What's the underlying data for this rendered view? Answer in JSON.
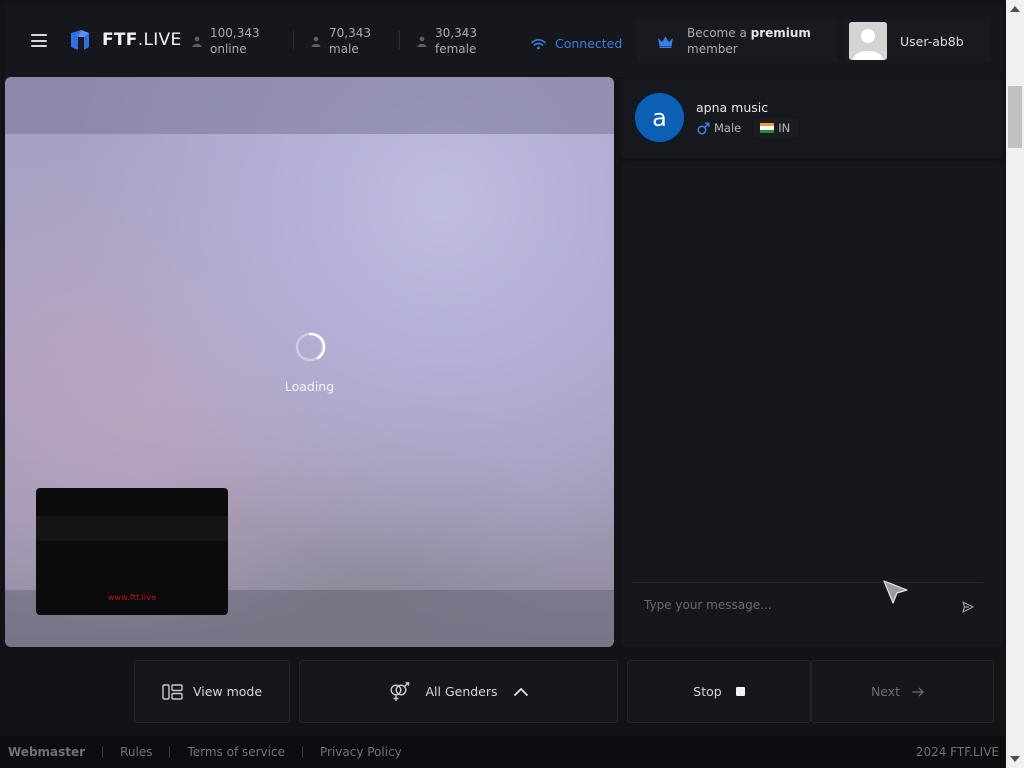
{
  "header": {
    "logo_strong": "FTF",
    "logo_rest": ".LIVE",
    "stats": [
      {
        "value": "100,343",
        "label": "online"
      },
      {
        "value": "70,343",
        "label": "male"
      },
      {
        "value": "30,343",
        "label": "female"
      }
    ],
    "connection_status": "Connected",
    "premium_prefix": "Become a ",
    "premium_bold": "premium",
    "premium_suffix": "member",
    "username": "User-ab8b"
  },
  "video": {
    "loading_text": "Loading",
    "self_preview_watermark": "www.ftf.live"
  },
  "partner": {
    "avatar_letter": "a",
    "name": "apna music",
    "gender": "Male",
    "country": "IN"
  },
  "chat": {
    "placeholder": "Type your message..."
  },
  "controls": {
    "view_mode": "View mode",
    "gender_filter": "All Genders",
    "stop": "Stop",
    "next": "Next"
  },
  "footer": {
    "links": [
      "Webmaster",
      "Rules",
      "Terms of service",
      "Privacy Policy"
    ],
    "copyright": "2024 FTF.LIVE"
  },
  "colors": {
    "accent_blue": "#3c7fe0",
    "avatar_blue": "#0d5fb3",
    "watermark_red": "#b5141a"
  },
  "icons": [
    "menu-icon",
    "logo-icon",
    "person-icon",
    "wifi-icon",
    "crown-icon",
    "user-avatar-icon",
    "male-icon",
    "india-flag-icon",
    "send-icon",
    "view-mode-icon",
    "gender-icon",
    "chevron-up-icon",
    "stop-icon",
    "arrow-right-icon",
    "loading-spinner"
  ]
}
